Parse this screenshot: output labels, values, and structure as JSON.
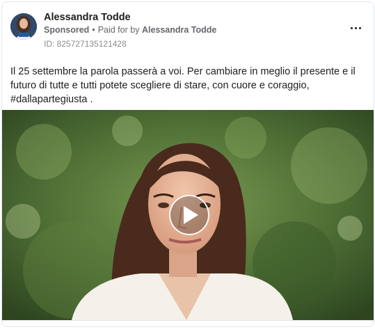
{
  "ad": {
    "advertiser": "Alessandra Todde",
    "sponsored_label": "Sponsored",
    "paid_for_label": "Paid for by",
    "payer": "Alessandra Todde",
    "ad_id": "ID: 825727135121428",
    "body": "Il 25 settembre la parola passerà a voi. Per cambiare in meglio il presente e il futuro di tutte e tutti potete scegliere di stare, con cuore e coraggio, #dallapartegiusta ."
  },
  "icons": {
    "more": "more-options-icon",
    "play": "play-icon"
  },
  "colors": {
    "text_primary": "#1c1e21",
    "text_secondary": "#65676b",
    "border": "#e4e6eb"
  }
}
